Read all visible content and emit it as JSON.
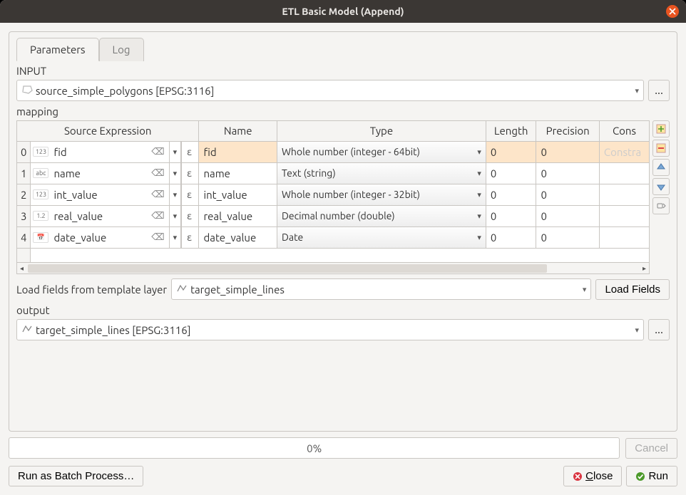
{
  "window": {
    "title": "ETL Basic Model (Append)"
  },
  "tabs": {
    "parameters": "Parameters",
    "log": "Log"
  },
  "input": {
    "label": "INPUT",
    "value": "source_simple_polygons [EPSG:3116]",
    "browse": "..."
  },
  "mapping": {
    "label": "mapping",
    "headers": {
      "source": "Source Expression",
      "name": "Name",
      "type": "Type",
      "length": "Length",
      "precision": "Precision",
      "constraints": "Cons"
    },
    "rows": [
      {
        "idx": "0",
        "badge": "123",
        "src": "fid",
        "name": "fid",
        "type": "Whole number (integer - 64bit)",
        "length": "0",
        "precision": "0",
        "constraints": "Constra",
        "highlight": true
      },
      {
        "idx": "1",
        "badge": "abc",
        "src": "name",
        "name": "name",
        "type": "Text (string)",
        "length": "0",
        "precision": "0",
        "constraints": "",
        "highlight": false
      },
      {
        "idx": "2",
        "badge": "123",
        "src": "int_value",
        "name": "int_value",
        "type": "Whole number (integer - 32bit)",
        "length": "0",
        "precision": "0",
        "constraints": "",
        "highlight": false
      },
      {
        "idx": "3",
        "badge": "1.2",
        "src": "real_value",
        "name": "real_value",
        "type": "Decimal number (double)",
        "length": "0",
        "precision": "0",
        "constraints": "",
        "highlight": false
      },
      {
        "idx": "4",
        "badge": "📅",
        "src": "date_value",
        "name": "date_value",
        "type": "Date",
        "length": "0",
        "precision": "0",
        "constraints": "",
        "highlight": false
      }
    ]
  },
  "template": {
    "label": "Load fields from template layer",
    "value": "target_simple_lines",
    "load_btn": "Load Fields"
  },
  "output": {
    "label": "output",
    "value": "target_simple_lines [EPSG:3116]",
    "browse": "..."
  },
  "progress": {
    "text": "0%",
    "cancel": "Cancel"
  },
  "footer": {
    "batch": "Run as Batch Process…",
    "close": "Close",
    "run": "Run"
  }
}
